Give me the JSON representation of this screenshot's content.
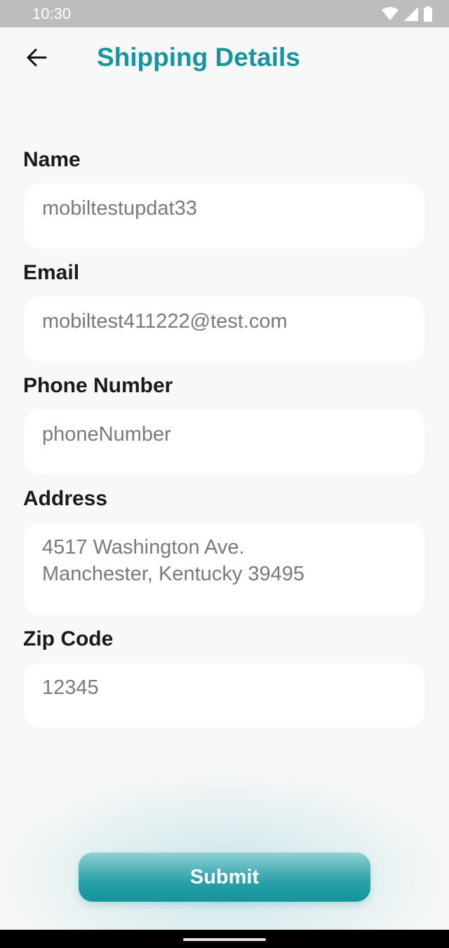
{
  "status_bar": {
    "time": "10:30",
    "icons": [
      "wifi-icon",
      "signal-icon",
      "battery-icon"
    ]
  },
  "header": {
    "back_icon": "arrow-left-icon",
    "title": "Shipping Details"
  },
  "form": {
    "name": {
      "label": "Name",
      "value": "mobiltestupdat33"
    },
    "email": {
      "label": "Email",
      "value": "mobiltest411222@test.com"
    },
    "phone": {
      "label": "Phone Number",
      "value": "phoneNumber"
    },
    "address": {
      "label": "Address",
      "value": "4517 Washington Ave.\nManchester, Kentucky 39495"
    },
    "zip": {
      "label": "Zip Code",
      "value": "12345"
    }
  },
  "submit": {
    "label": "Submit"
  },
  "colors": {
    "accent": "#17959d",
    "background": "#f8f8f8",
    "field_text": "#7a7a7a"
  }
}
